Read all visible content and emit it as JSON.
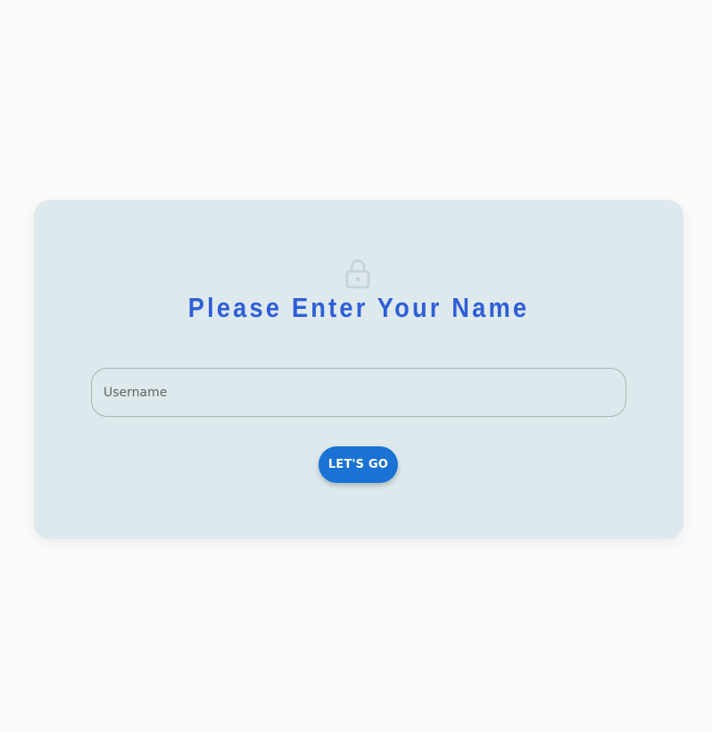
{
  "login": {
    "title": "Please Enter Your Name",
    "username_placeholder": "Username",
    "username_value": "",
    "submit_label": "LET'S GO"
  },
  "icons": {
    "header_icon": "lock-icon"
  },
  "colors": {
    "background": "#fafafa",
    "card": "#dde9ec",
    "title": "#2f5fd6",
    "button": "#1a73d4",
    "button_text": "#ffffff",
    "icon": "#c9d4d8"
  }
}
